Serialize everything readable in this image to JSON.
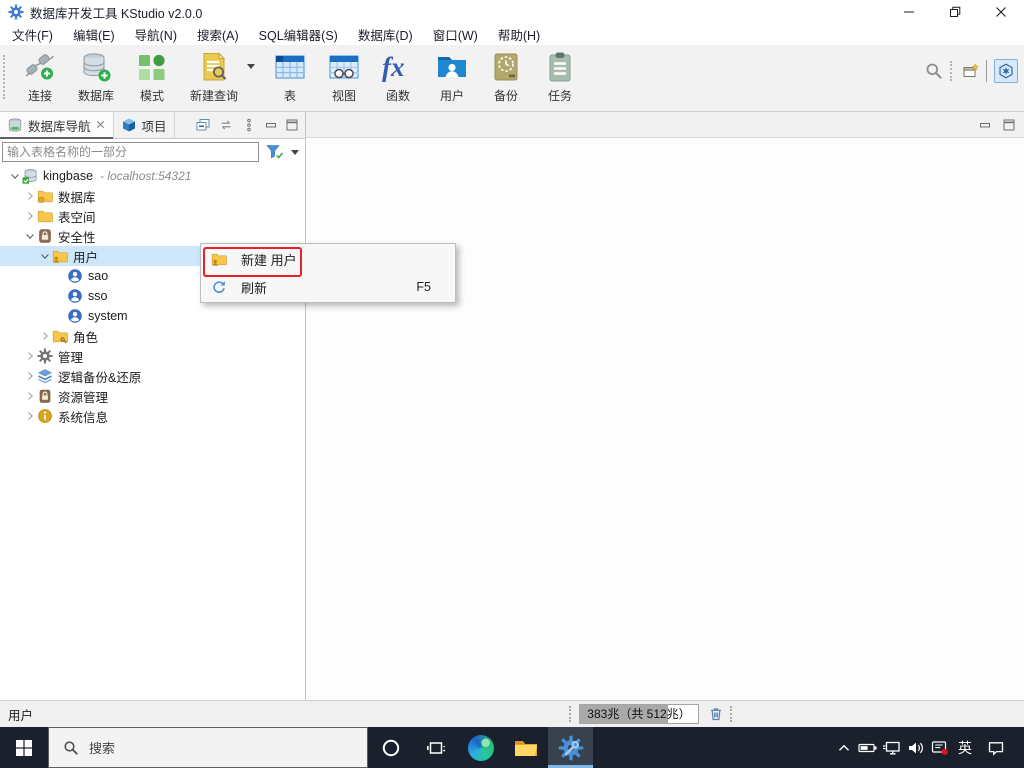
{
  "window": {
    "title": "数据库开发工具 KStudio v2.0.0"
  },
  "menubar": {
    "items": [
      "文件(F)",
      "编辑(E)",
      "导航(N)",
      "搜索(A)",
      "SQL编辑器(S)",
      "数据库(D)",
      "窗口(W)",
      "帮助(H)"
    ]
  },
  "toolbar": {
    "buttons": [
      {
        "id": "connect",
        "label": "连接",
        "icon": "plug-add",
        "dropdown": false
      },
      {
        "id": "database",
        "label": "数据库",
        "icon": "database-add",
        "dropdown": false
      },
      {
        "id": "schema",
        "label": "模式",
        "icon": "schema",
        "dropdown": false
      },
      {
        "id": "new-query",
        "label": "新建查询",
        "icon": "new-query",
        "dropdown": true
      },
      {
        "id": "table",
        "label": "表",
        "icon": "table",
        "dropdown": false
      },
      {
        "id": "view",
        "label": "视图",
        "icon": "view",
        "dropdown": false
      },
      {
        "id": "function",
        "label": "函数",
        "icon": "function",
        "dropdown": false
      },
      {
        "id": "user",
        "label": "用户",
        "icon": "user-folder",
        "dropdown": false
      },
      {
        "id": "backup",
        "label": "备份",
        "icon": "backup",
        "dropdown": false
      },
      {
        "id": "task",
        "label": "任务",
        "icon": "task",
        "dropdown": false
      }
    ]
  },
  "navigator": {
    "tabs": [
      {
        "id": "db-nav",
        "label": "数据库导航",
        "icon": "db-nav",
        "active": true,
        "closable": true
      },
      {
        "id": "project",
        "label": "项目",
        "icon": "project-cube",
        "active": false,
        "closable": false
      }
    ],
    "filter_placeholder": "输入表格名称的一部分",
    "tree": [
      {
        "label": "kingbase",
        "suffix": "- localhost:54321",
        "level": 0,
        "state": "expanded",
        "icon": "conn-db"
      },
      {
        "label": "数据库",
        "level": 1,
        "state": "collapsed",
        "icon": "folder-db"
      },
      {
        "label": "表空间",
        "level": 1,
        "state": "collapsed",
        "icon": "folder"
      },
      {
        "label": "安全性",
        "level": 1,
        "state": "expanded",
        "icon": "security"
      },
      {
        "label": "用户",
        "level": 2,
        "state": "expanded",
        "icon": "folder-user",
        "selected": true
      },
      {
        "label": "sao",
        "level": 3,
        "state": "leaf",
        "icon": "person"
      },
      {
        "label": "sso",
        "level": 3,
        "state": "leaf",
        "icon": "person"
      },
      {
        "label": "system",
        "level": 3,
        "state": "leaf",
        "icon": "person"
      },
      {
        "label": "角色",
        "level": 2,
        "state": "collapsed",
        "icon": "folder-role"
      },
      {
        "label": "管理",
        "level": 1,
        "state": "collapsed",
        "icon": "gear-gray"
      },
      {
        "label": "逻辑备份&还原",
        "level": 1,
        "state": "collapsed",
        "icon": "layers"
      },
      {
        "label": "资源管理",
        "level": 1,
        "state": "collapsed",
        "icon": "lock"
      },
      {
        "label": "系统信息",
        "level": 1,
        "state": "collapsed",
        "icon": "info"
      }
    ]
  },
  "context_menu": {
    "items": [
      {
        "label": "新建 用户",
        "icon": "folder-user",
        "shortcut": "",
        "annotated": true
      },
      {
        "label": "刷新",
        "icon": "refresh",
        "shortcut": "F5",
        "annotated": false
      }
    ]
  },
  "statusbar": {
    "selection": "用户",
    "memory": {
      "label": "383兆（共 512兆）",
      "used_mb": 383,
      "total_mb": 512
    }
  },
  "taskbar": {
    "search_placeholder": "搜索",
    "language": "英"
  }
}
